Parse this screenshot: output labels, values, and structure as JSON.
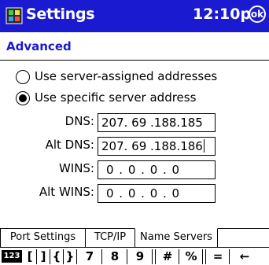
{
  "titlebar": {
    "app_title": "Settings",
    "time": "12:10p",
    "ok_label": "ok"
  },
  "section": {
    "title": "Advanced"
  },
  "radios": [
    {
      "label": "Use server-assigned addresses",
      "checked": false
    },
    {
      "label": "Use specific server address",
      "checked": true
    }
  ],
  "fields": [
    {
      "label": "DNS:",
      "value": "207. 69 .188.185"
    },
    {
      "label": "Alt DNS:",
      "value": "207. 69 .188.186"
    },
    {
      "label": "WINS:",
      "value": "0 . 0 . 0 . 0"
    },
    {
      "label": "Alt WINS:",
      "value": "0 . 0 . 0 . 0"
    }
  ],
  "tabs": [
    {
      "label": "Port Settings",
      "active": false
    },
    {
      "label": "TCP/IP",
      "active": false
    },
    {
      "label": "Name Servers",
      "active": true
    }
  ],
  "keyboard": {
    "toggle_label": "123",
    "keys": [
      "[",
      "]",
      "{",
      "}",
      "7",
      "8",
      "9",
      "#",
      "%",
      "=",
      "←"
    ]
  },
  "colors": {
    "titlebar_bg": "#1a1ad0",
    "accent_text": "#1a1ad0"
  },
  "icons": {
    "app": "settings-icon",
    "ok": "ok-button",
    "backspace": "backspace-icon"
  }
}
